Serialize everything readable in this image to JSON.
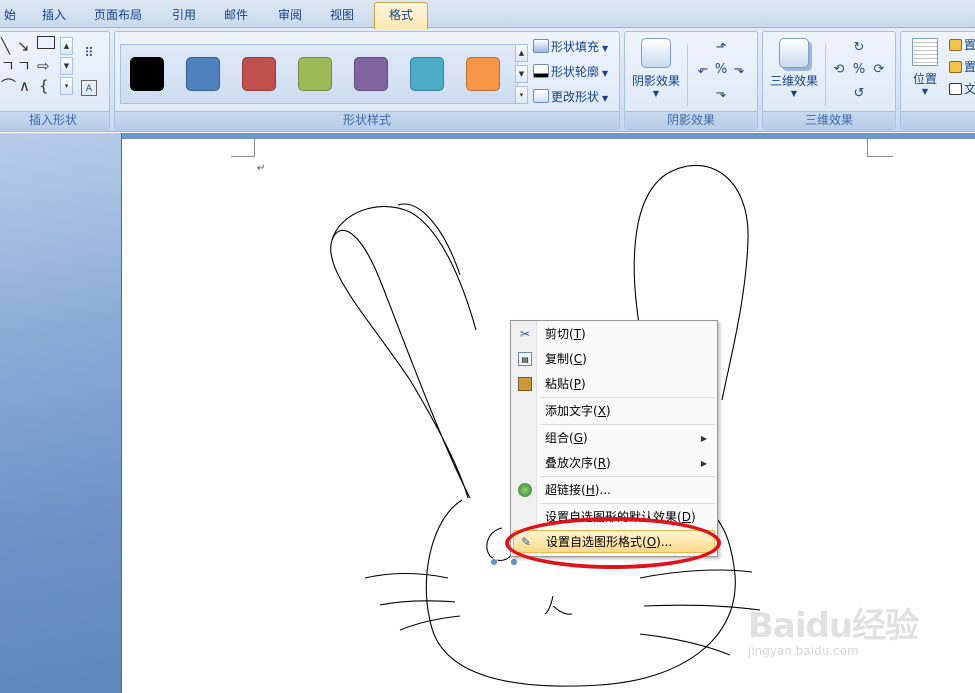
{
  "tabs": [
    {
      "label": "始"
    },
    {
      "label": "插入"
    },
    {
      "label": "页面布局"
    },
    {
      "label": "引用"
    },
    {
      "label": "邮件"
    },
    {
      "label": "审阅"
    },
    {
      "label": "视图"
    },
    {
      "label": "格式",
      "active": true
    }
  ],
  "ribbon": {
    "insert_shapes": {
      "label": "插入形状"
    },
    "shape_styles": {
      "label": "形状样式",
      "swatches": [
        "#000000",
        "#4f81bd",
        "#c0504d",
        "#9bbb59",
        "#8064a2",
        "#4bacc6",
        "#f79646"
      ],
      "fill": "形状填充",
      "outline": "形状轮廓",
      "change": "更改形状"
    },
    "shadow": {
      "button": "阴影效果",
      "label": "阴影效果"
    },
    "three_d": {
      "button": "三维效果",
      "label": "三维效果"
    },
    "arrange": {
      "position": "位置",
      "items": [
        "置",
        "置",
        "文"
      ]
    }
  },
  "context_menu": {
    "items": [
      {
        "label": "剪切(",
        "key": "T",
        "suffix": ")",
        "icon": "scissors-icon"
      },
      {
        "label": "复制(",
        "key": "C",
        "suffix": ")",
        "icon": "copy-icon"
      },
      {
        "label": "粘贴(",
        "key": "P",
        "suffix": ")",
        "icon": "paste-icon"
      },
      {
        "label": "添加文字(",
        "key": "X",
        "suffix": ")",
        "icon": ""
      },
      {
        "label": "组合(",
        "key": "G",
        "suffix": ")",
        "icon": "",
        "submenu": true
      },
      {
        "label": "叠放次序(",
        "key": "R",
        "suffix": ")",
        "icon": "",
        "submenu": true
      },
      {
        "label": "超链接(",
        "key": "H",
        "suffix": ")...",
        "icon": "hyperlink-icon"
      },
      {
        "label": "设置自选图形的默认效果(",
        "key": "D",
        "suffix": ")",
        "icon": ""
      },
      {
        "label": "设置自选图形格式(",
        "key": "O",
        "suffix": ")...",
        "icon": "format-shape-icon",
        "highlighted": true
      }
    ]
  },
  "watermark": {
    "brand": "Baidu经验",
    "url": "jingyan.baidu.com"
  },
  "colors": {
    "highlight_ring": "#e0121b",
    "accent": "#15428b"
  }
}
